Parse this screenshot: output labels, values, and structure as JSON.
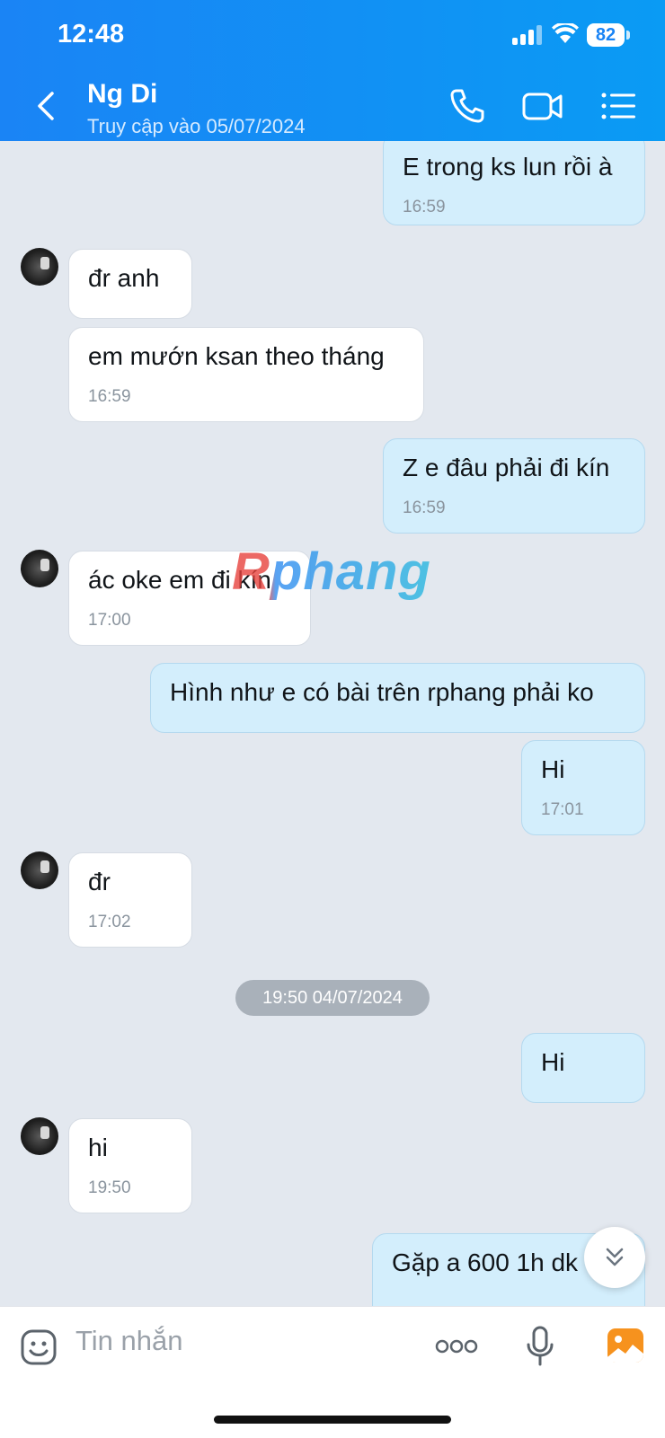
{
  "status_bar": {
    "time": "12:48",
    "battery": "82"
  },
  "header": {
    "name": "Ng Di",
    "status": "Truy cập vào 05/07/2024"
  },
  "messages": [
    {
      "text": "E trong ks lun rồi à",
      "time": "16:59"
    },
    {
      "text": "đr anh"
    },
    {
      "text": "em mướn ksan theo tháng",
      "time": "16:59"
    },
    {
      "text": "Z e đâu phải đi kín",
      "time": "16:59"
    },
    {
      "text": "ác oke em đi kín",
      "time": "17:00"
    },
    {
      "text": "Hình như e có bài trên rphang phải ko"
    },
    {
      "text": "Hi",
      "time": "17:01"
    },
    {
      "text": "đr",
      "time": "17:02"
    },
    {
      "text": "Hi"
    },
    {
      "text": "hi",
      "time": "19:50"
    },
    {
      "text": "Gặp a 600 1h dk"
    }
  ],
  "date_separator": "19:50 04/07/2024",
  "watermark": "Rphang",
  "composer": {
    "placeholder": "Tin nhắn"
  },
  "colors": {
    "header": "#1a84f5",
    "outgoing_bubble": "#d3eefc",
    "incoming_bubble": "#ffffff",
    "chat_bg": "#e3e8ef"
  }
}
